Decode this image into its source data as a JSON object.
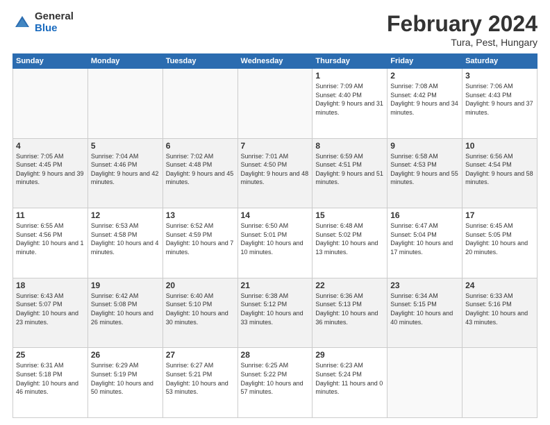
{
  "logo": {
    "general": "General",
    "blue": "Blue"
  },
  "header": {
    "month": "February 2024",
    "location": "Tura, Pest, Hungary"
  },
  "weekdays": [
    "Sunday",
    "Monday",
    "Tuesday",
    "Wednesday",
    "Thursday",
    "Friday",
    "Saturday"
  ],
  "weeks": [
    {
      "shaded": false,
      "days": [
        {
          "num": "",
          "detail": ""
        },
        {
          "num": "",
          "detail": ""
        },
        {
          "num": "",
          "detail": ""
        },
        {
          "num": "",
          "detail": ""
        },
        {
          "num": "1",
          "detail": "Sunrise: 7:09 AM\nSunset: 4:40 PM\nDaylight: 9 hours\nand 31 minutes."
        },
        {
          "num": "2",
          "detail": "Sunrise: 7:08 AM\nSunset: 4:42 PM\nDaylight: 9 hours\nand 34 minutes."
        },
        {
          "num": "3",
          "detail": "Sunrise: 7:06 AM\nSunset: 4:43 PM\nDaylight: 9 hours\nand 37 minutes."
        }
      ]
    },
    {
      "shaded": true,
      "days": [
        {
          "num": "4",
          "detail": "Sunrise: 7:05 AM\nSunset: 4:45 PM\nDaylight: 9 hours\nand 39 minutes."
        },
        {
          "num": "5",
          "detail": "Sunrise: 7:04 AM\nSunset: 4:46 PM\nDaylight: 9 hours\nand 42 minutes."
        },
        {
          "num": "6",
          "detail": "Sunrise: 7:02 AM\nSunset: 4:48 PM\nDaylight: 9 hours\nand 45 minutes."
        },
        {
          "num": "7",
          "detail": "Sunrise: 7:01 AM\nSunset: 4:50 PM\nDaylight: 9 hours\nand 48 minutes."
        },
        {
          "num": "8",
          "detail": "Sunrise: 6:59 AM\nSunset: 4:51 PM\nDaylight: 9 hours\nand 51 minutes."
        },
        {
          "num": "9",
          "detail": "Sunrise: 6:58 AM\nSunset: 4:53 PM\nDaylight: 9 hours\nand 55 minutes."
        },
        {
          "num": "10",
          "detail": "Sunrise: 6:56 AM\nSunset: 4:54 PM\nDaylight: 9 hours\nand 58 minutes."
        }
      ]
    },
    {
      "shaded": false,
      "days": [
        {
          "num": "11",
          "detail": "Sunrise: 6:55 AM\nSunset: 4:56 PM\nDaylight: 10 hours\nand 1 minute."
        },
        {
          "num": "12",
          "detail": "Sunrise: 6:53 AM\nSunset: 4:58 PM\nDaylight: 10 hours\nand 4 minutes."
        },
        {
          "num": "13",
          "detail": "Sunrise: 6:52 AM\nSunset: 4:59 PM\nDaylight: 10 hours\nand 7 minutes."
        },
        {
          "num": "14",
          "detail": "Sunrise: 6:50 AM\nSunset: 5:01 PM\nDaylight: 10 hours\nand 10 minutes."
        },
        {
          "num": "15",
          "detail": "Sunrise: 6:48 AM\nSunset: 5:02 PM\nDaylight: 10 hours\nand 13 minutes."
        },
        {
          "num": "16",
          "detail": "Sunrise: 6:47 AM\nSunset: 5:04 PM\nDaylight: 10 hours\nand 17 minutes."
        },
        {
          "num": "17",
          "detail": "Sunrise: 6:45 AM\nSunset: 5:05 PM\nDaylight: 10 hours\nand 20 minutes."
        }
      ]
    },
    {
      "shaded": true,
      "days": [
        {
          "num": "18",
          "detail": "Sunrise: 6:43 AM\nSunset: 5:07 PM\nDaylight: 10 hours\nand 23 minutes."
        },
        {
          "num": "19",
          "detail": "Sunrise: 6:42 AM\nSunset: 5:08 PM\nDaylight: 10 hours\nand 26 minutes."
        },
        {
          "num": "20",
          "detail": "Sunrise: 6:40 AM\nSunset: 5:10 PM\nDaylight: 10 hours\nand 30 minutes."
        },
        {
          "num": "21",
          "detail": "Sunrise: 6:38 AM\nSunset: 5:12 PM\nDaylight: 10 hours\nand 33 minutes."
        },
        {
          "num": "22",
          "detail": "Sunrise: 6:36 AM\nSunset: 5:13 PM\nDaylight: 10 hours\nand 36 minutes."
        },
        {
          "num": "23",
          "detail": "Sunrise: 6:34 AM\nSunset: 5:15 PM\nDaylight: 10 hours\nand 40 minutes."
        },
        {
          "num": "24",
          "detail": "Sunrise: 6:33 AM\nSunset: 5:16 PM\nDaylight: 10 hours\nand 43 minutes."
        }
      ]
    },
    {
      "shaded": false,
      "days": [
        {
          "num": "25",
          "detail": "Sunrise: 6:31 AM\nSunset: 5:18 PM\nDaylight: 10 hours\nand 46 minutes."
        },
        {
          "num": "26",
          "detail": "Sunrise: 6:29 AM\nSunset: 5:19 PM\nDaylight: 10 hours\nand 50 minutes."
        },
        {
          "num": "27",
          "detail": "Sunrise: 6:27 AM\nSunset: 5:21 PM\nDaylight: 10 hours\nand 53 minutes."
        },
        {
          "num": "28",
          "detail": "Sunrise: 6:25 AM\nSunset: 5:22 PM\nDaylight: 10 hours\nand 57 minutes."
        },
        {
          "num": "29",
          "detail": "Sunrise: 6:23 AM\nSunset: 5:24 PM\nDaylight: 11 hours\nand 0 minutes."
        },
        {
          "num": "",
          "detail": ""
        },
        {
          "num": "",
          "detail": ""
        }
      ]
    }
  ]
}
